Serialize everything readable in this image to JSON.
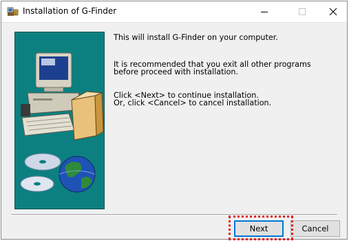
{
  "window": {
    "title": "Installation of G-Finder"
  },
  "content": {
    "line1": "This will install G-Finder on your computer.",
    "line2a": "It is recommended that you exit all other programs",
    "line2b": "before proceed with installation.",
    "line3a": "Click <Next> to continue installation.",
    "line3b": "Or, click <Cancel> to cancel installation."
  },
  "buttons": {
    "next_label": "Next",
    "cancel_label": "Cancel"
  },
  "colors": {
    "side_panel": "#0c8080",
    "highlight": "#e0191b",
    "default_button_border": "#0078d7"
  },
  "icons": {
    "title": "installer-icon",
    "minimize": "minimize-icon",
    "maximize": "maximize-icon",
    "close": "close-icon",
    "side_art": "computer-cd-globe-illustration"
  }
}
